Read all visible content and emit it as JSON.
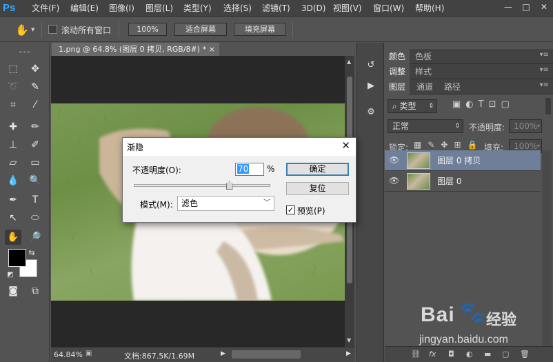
{
  "app": {
    "logo": "Ps"
  },
  "menu": [
    "文件(F)",
    "编辑(E)",
    "图像(I)",
    "图层(L)",
    "类型(Y)",
    "选择(S)",
    "滤镜(T)",
    "3D(D)",
    "视图(V)",
    "窗口(W)",
    "帮助(H)"
  ],
  "window_controls": {
    "minimize": "—",
    "maximize": "□",
    "close": "✕"
  },
  "options": {
    "scroll_all_label": "滚动所有窗口",
    "zoom_btn": "100%",
    "fit_btn": "适合屏幕",
    "fill_btn": "填充屏幕"
  },
  "document": {
    "tab_title": "1.png @ 64.8% (图层 0 拷贝, RGB/8#) *",
    "tab_close": "×",
    "zoom": "64.84%",
    "doc_info": "文档:867.5K/1.69M"
  },
  "panels": {
    "group1": [
      "颜色",
      "色板"
    ],
    "group2": [
      "调整",
      "样式"
    ],
    "group3": [
      "图层",
      "通道",
      "路径"
    ],
    "filter_kind": "类型",
    "blend_mode": "正常",
    "opacity_label": "不透明度:",
    "opacity_value": "100%",
    "lock_label": "锁定:",
    "fill_label": "填充:",
    "fill_value": "100%",
    "layers": [
      {
        "name": "图层 0 拷贝",
        "selected": true
      },
      {
        "name": "图层 0",
        "selected": false
      }
    ]
  },
  "dialog": {
    "title": "渐隐",
    "close": "✕",
    "opacity_label": "不透明度(O):",
    "opacity_value": "70",
    "percent": "%",
    "opacity_fraction": 0.7,
    "ok": "确定",
    "reset": "复位",
    "mode_label": "模式(M):",
    "mode_value": "滤色",
    "preview_label": "预览(P)",
    "preview_checked": true
  },
  "watermark": {
    "brand": "Bai",
    "cn": "经验",
    "url": "jingyan.baidu.com"
  }
}
